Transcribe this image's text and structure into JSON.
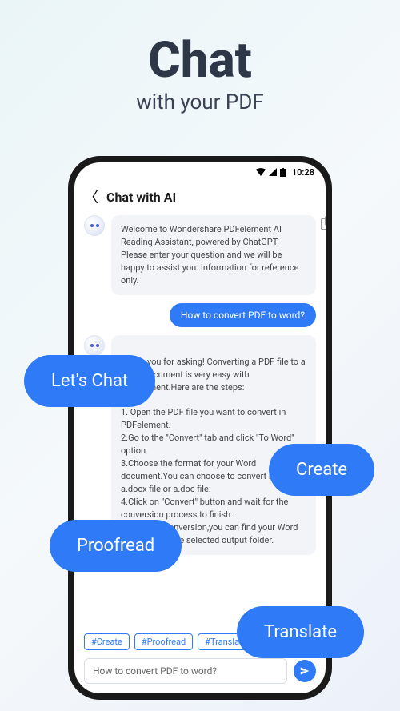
{
  "hero": {
    "title": "Chat",
    "subtitle": "with your PDF"
  },
  "statusbar": {
    "time": "10:28"
  },
  "appbar": {
    "title": "Chat with AI"
  },
  "messages": {
    "ai_welcome": "Welcome to Wondershare PDFelement AI Reading Assistant, powered by ChatGPT. Please enter your question and we will be happy to assist you. Information for reference only.",
    "user_q": "How to convert PDF to word?",
    "ai_answer": "Thank you for asking! Converting a PDF file to a Word document is very easy with PDFelement.Here are the steps:\n\n1. Open the PDF file you want to convert in PDFelement.\n2.Go to the \"Convert\" tab and click \"To Word\" option.\n3.Choose the format for your Word document.You can choose to convert it to a.docx file or a.doc file.\n4.Click on \"Convert\" button and wait for the conversion process to finish.\n5.After the conversion,you can find your Word document in the selected output folder."
  },
  "chips": {
    "create": "#Create",
    "proofread": "#Proofread",
    "translate": "#Translate"
  },
  "input": {
    "placeholder": "How to convert PDF to word?"
  },
  "pills": {
    "lets_chat": "Let's Chat",
    "create": "Create",
    "proofread": "Proofread",
    "translate": "Translate"
  }
}
